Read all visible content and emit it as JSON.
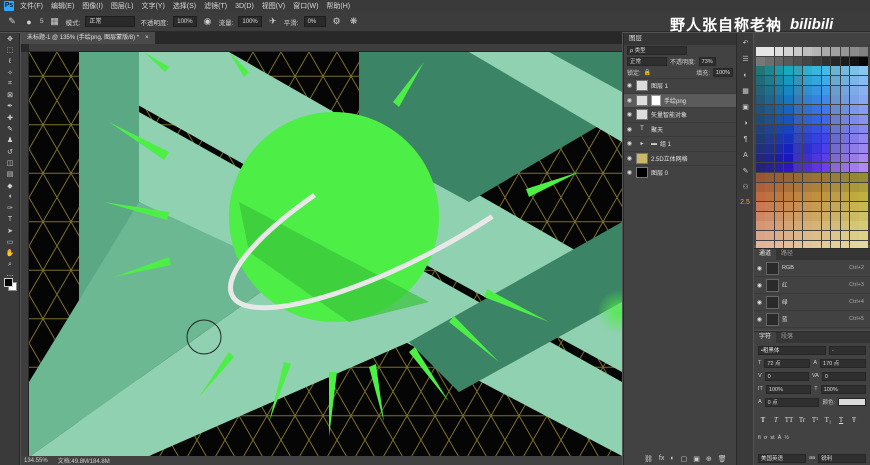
{
  "menubar": {
    "logo": "Ps",
    "items": [
      "文件(F)",
      "编辑(E)",
      "图像(I)",
      "图层(L)",
      "文字(Y)",
      "选择(S)",
      "滤镜(T)",
      "3D(D)",
      "视图(V)",
      "窗口(W)",
      "帮助(H)"
    ]
  },
  "options": {
    "mode_label": "模式:",
    "mode_value": "正常",
    "opacity_label": "不透明度:",
    "opacity_value": "100%",
    "flow_label": "流量:",
    "flow_value": "100%",
    "smooth_label": "平滑:",
    "smooth_value": "0%",
    "brush_size": "5"
  },
  "watermark": {
    "text": "野人张自称老衲",
    "logo": "bilibili"
  },
  "document": {
    "tab_title": "未标题-1 @ 135% (手绘png, 图层蒙版/8) *",
    "close": "×",
    "status_zoom": "134.55%",
    "status_doc": "文档:49.8M/184.8M"
  },
  "layers": {
    "tab": "图层",
    "kind_label": "ρ 类型",
    "blend": "正常",
    "opacity_label": "不透明度:",
    "opacity_value": "73%",
    "lock_label": "锁定:",
    "fill_label": "填充:",
    "fill_value": "100%",
    "items": [
      {
        "name": "图层 1",
        "selected": false,
        "thumb": ""
      },
      {
        "name": "手绘png",
        "selected": true,
        "thumb": ""
      },
      {
        "name": "矢量智能对象",
        "selected": false,
        "thumb": ""
      },
      {
        "name": "聚天",
        "selected": false,
        "thumb": "T"
      },
      {
        "name": "组 1",
        "selected": false,
        "thumb": "▸"
      },
      {
        "name": "2.5D立体网格",
        "selected": false,
        "thumb": ""
      },
      {
        "name": "图层 0",
        "selected": false,
        "thumb": ""
      }
    ],
    "footer": [
      "fx",
      "◐",
      "▢",
      "▣",
      "⊕",
      "🗑"
    ]
  },
  "iconcol": {
    "number": "2.5"
  },
  "channels": {
    "tabs": [
      "通道",
      "路径"
    ],
    "rows": [
      {
        "name": "RGB",
        "key": "Ctrl+2"
      },
      {
        "name": "红",
        "key": "Ctrl+3"
      },
      {
        "name": "绿",
        "key": "Ctrl+4"
      },
      {
        "name": "蓝",
        "key": "Ctrl+5"
      }
    ]
  },
  "character": {
    "tabs": [
      "字符",
      "段落"
    ],
    "font": "•粗黑体",
    "font_style": "-",
    "size": "72 点",
    "leading": "170 点",
    "tracking": "0",
    "kerning": "0",
    "vscale": "100%",
    "hscale": "100%",
    "baseline": "0 点",
    "color_label": "颜色:",
    "styles": [
      "T",
      "T",
      "TT",
      "Tr",
      "T¹",
      "T₁",
      "T",
      "Ŧ"
    ],
    "lang": "美国英语",
    "aa_label": "aa",
    "aa_value": "锐利"
  },
  "colors": {
    "canvas_bg": "#050505",
    "teal_light": "#8fd1b0",
    "teal_mid": "#5aa884",
    "teal_dark": "#3c8466",
    "neon_green": "#4dee45",
    "grid_line": "#7a6f2c"
  }
}
